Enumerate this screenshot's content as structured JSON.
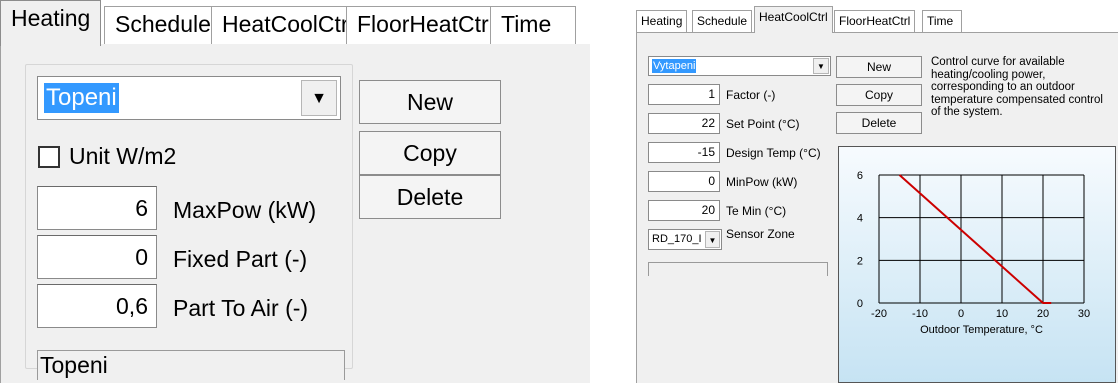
{
  "left_panel": {
    "tabs": [
      "Heating",
      "Schedule",
      "HeatCoolCtrl",
      "FloorHeatCtrl",
      "Time"
    ],
    "active_tab": "Heating",
    "combo_value": "Topeni",
    "unit_checkbox": {
      "label": "Unit W/m2",
      "checked": false
    },
    "fields": [
      {
        "value": "6",
        "label": "MaxPow (kW)"
      },
      {
        "value": "0",
        "label": "Fixed Part (-)"
      },
      {
        "value": "0,6",
        "label": "Part To Air (-)"
      }
    ],
    "buttons": {
      "new": "New",
      "copy": "Copy",
      "delete": "Delete"
    },
    "status_text": "Topeni"
  },
  "right_panel": {
    "tabs": [
      "Heating",
      "Schedule",
      "HeatCoolCtrl",
      "FloorHeatCtrl",
      "Time"
    ],
    "active_tab": "HeatCoolCtrl",
    "combo_value": "Vytapeni",
    "fields": [
      {
        "value": "1",
        "label": "Factor (-)"
      },
      {
        "value": "22",
        "label": "Set Point (°C)"
      },
      {
        "value": "-15",
        "label": "Design Temp (°C)"
      },
      {
        "value": "0",
        "label": "MinPow (kW)"
      },
      {
        "value": "20",
        "label": "Te Min (°C)"
      }
    ],
    "sensor_zone": {
      "value": "RD_170_I",
      "label": "Sensor Zone"
    },
    "buttons": {
      "new": "New",
      "copy": "Copy",
      "delete": "Delete"
    },
    "description": "Control curve for available heating/cooling power, corresponding to an outdoor temperature compensated control of the system."
  },
  "chart_data": {
    "type": "line",
    "xlabel": "Outdoor Temperature, °C",
    "ylabel": "",
    "xlim": [
      -20,
      30
    ],
    "ylim": [
      0,
      6
    ],
    "x_ticks": [
      "-20",
      "-10",
      "0",
      "10",
      "20",
      "30"
    ],
    "y_ticks": [
      "0",
      "2",
      "4",
      "6"
    ],
    "grid": true,
    "series": [
      {
        "color": "#cc0000",
        "x": [
          -15,
          20,
          22
        ],
        "y": [
          6,
          0,
          0
        ]
      }
    ]
  }
}
